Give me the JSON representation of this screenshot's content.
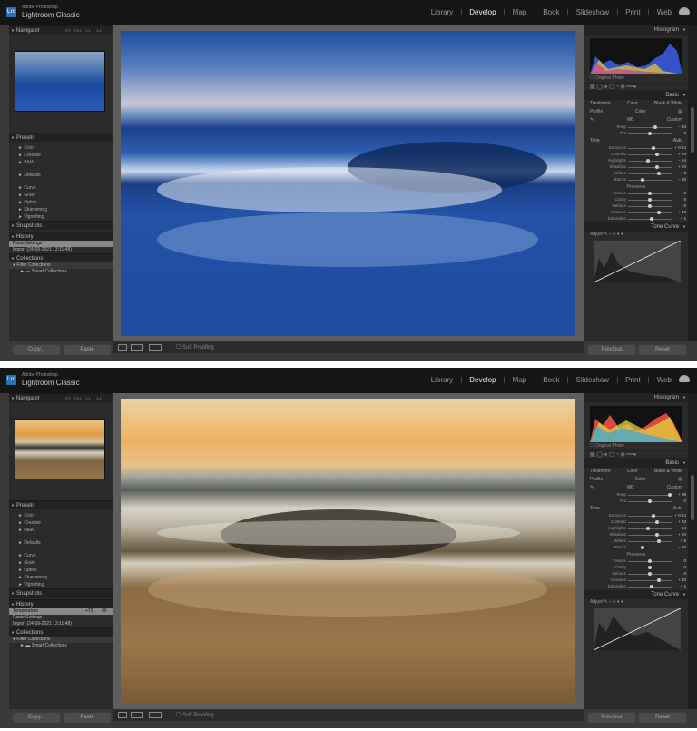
{
  "app": {
    "brand_top": "Adobe Photoshop",
    "brand_name": "Lightroom Classic",
    "logo": "Lrc"
  },
  "modules": [
    "Library",
    "Develop",
    "Map",
    "Book",
    "Slideshow",
    "Print",
    "Web"
  ],
  "left": {
    "navigator": "Navigator",
    "nav_opts": [
      "FIT",
      "FILL",
      "1:1",
      "1:4"
    ],
    "presets_title": "Presets",
    "presets": [
      "Color",
      "Creative",
      "B&W",
      "Defaults",
      "Curve",
      "Grain",
      "Optics",
      "Sharpening",
      "Vignetting"
    ],
    "snapshots": "Snapshots",
    "history": "History",
    "history_before": [
      "Paste Settings",
      "Import (24-09-2021 13:11:48)"
    ],
    "history_after": [
      "Temperature",
      "Paste Settings",
      "Import (24-09-2021 13:11:48)"
    ],
    "temp_delta": "+79",
    "temp_val": "99",
    "collections": "Collections",
    "collection_items": [
      "Filter Collections",
      "Smart Collections"
    ],
    "copy": "Copy...",
    "paste": "Paste"
  },
  "right": {
    "histogram": "Histogram",
    "original_photo": "Original Photo",
    "basic": "Basic",
    "treatment": "Treatment",
    "color": "Color",
    "bw": "Black & White",
    "profile": "Profile",
    "profile_val": "Color",
    "wb": "WB",
    "wb_val": "Custom",
    "tone": "Tone",
    "auto": "Auto",
    "presence": "Presence",
    "tone_curve": "Tone Curve",
    "adjust": "Adjust",
    "previous": "Previous",
    "reset": "Reset",
    "sliders_before": [
      {
        "name": "Temp",
        "val": "− 40"
      },
      {
        "name": "Tint",
        "val": "0"
      },
      {
        "name": "Exposure",
        "val": "+ 0.44"
      },
      {
        "name": "Contrast",
        "val": "+ 23"
      },
      {
        "name": "Highlights",
        "val": "− 64"
      },
      {
        "name": "Shadows",
        "val": "+ 24"
      },
      {
        "name": "Whites",
        "val": "+ 8"
      },
      {
        "name": "Blacks",
        "val": "− 60"
      },
      {
        "name": "Texture",
        "val": "0"
      },
      {
        "name": "Clarity",
        "val": "0"
      },
      {
        "name": "Dehaze",
        "val": "0"
      },
      {
        "name": "Vibrance",
        "val": "+ 40"
      },
      {
        "name": "Saturation",
        "val": "+ 1"
      }
    ],
    "sliders_after": [
      {
        "name": "Temp",
        "val": "+ 39"
      },
      {
        "name": "Tint",
        "val": "0"
      },
      {
        "name": "Exposure",
        "val": "+ 0.44"
      },
      {
        "name": "Contrast",
        "val": "+ 23"
      },
      {
        "name": "Highlights",
        "val": "− 64"
      },
      {
        "name": "Shadows",
        "val": "+ 24"
      },
      {
        "name": "Whites",
        "val": "+ 8"
      },
      {
        "name": "Blacks",
        "val": "− 60"
      },
      {
        "name": "Texture",
        "val": "0"
      },
      {
        "name": "Clarity",
        "val": "0"
      },
      {
        "name": "Dehaze",
        "val": "0"
      },
      {
        "name": "Vibrance",
        "val": "+ 40"
      },
      {
        "name": "Saturation",
        "val": "+ 1"
      }
    ]
  },
  "bottom": {
    "soft_proofing": "Soft Proofing"
  },
  "colors": {
    "panel": "#2b2b2b",
    "bar": "#151515",
    "accent": "#2b6fb5"
  }
}
